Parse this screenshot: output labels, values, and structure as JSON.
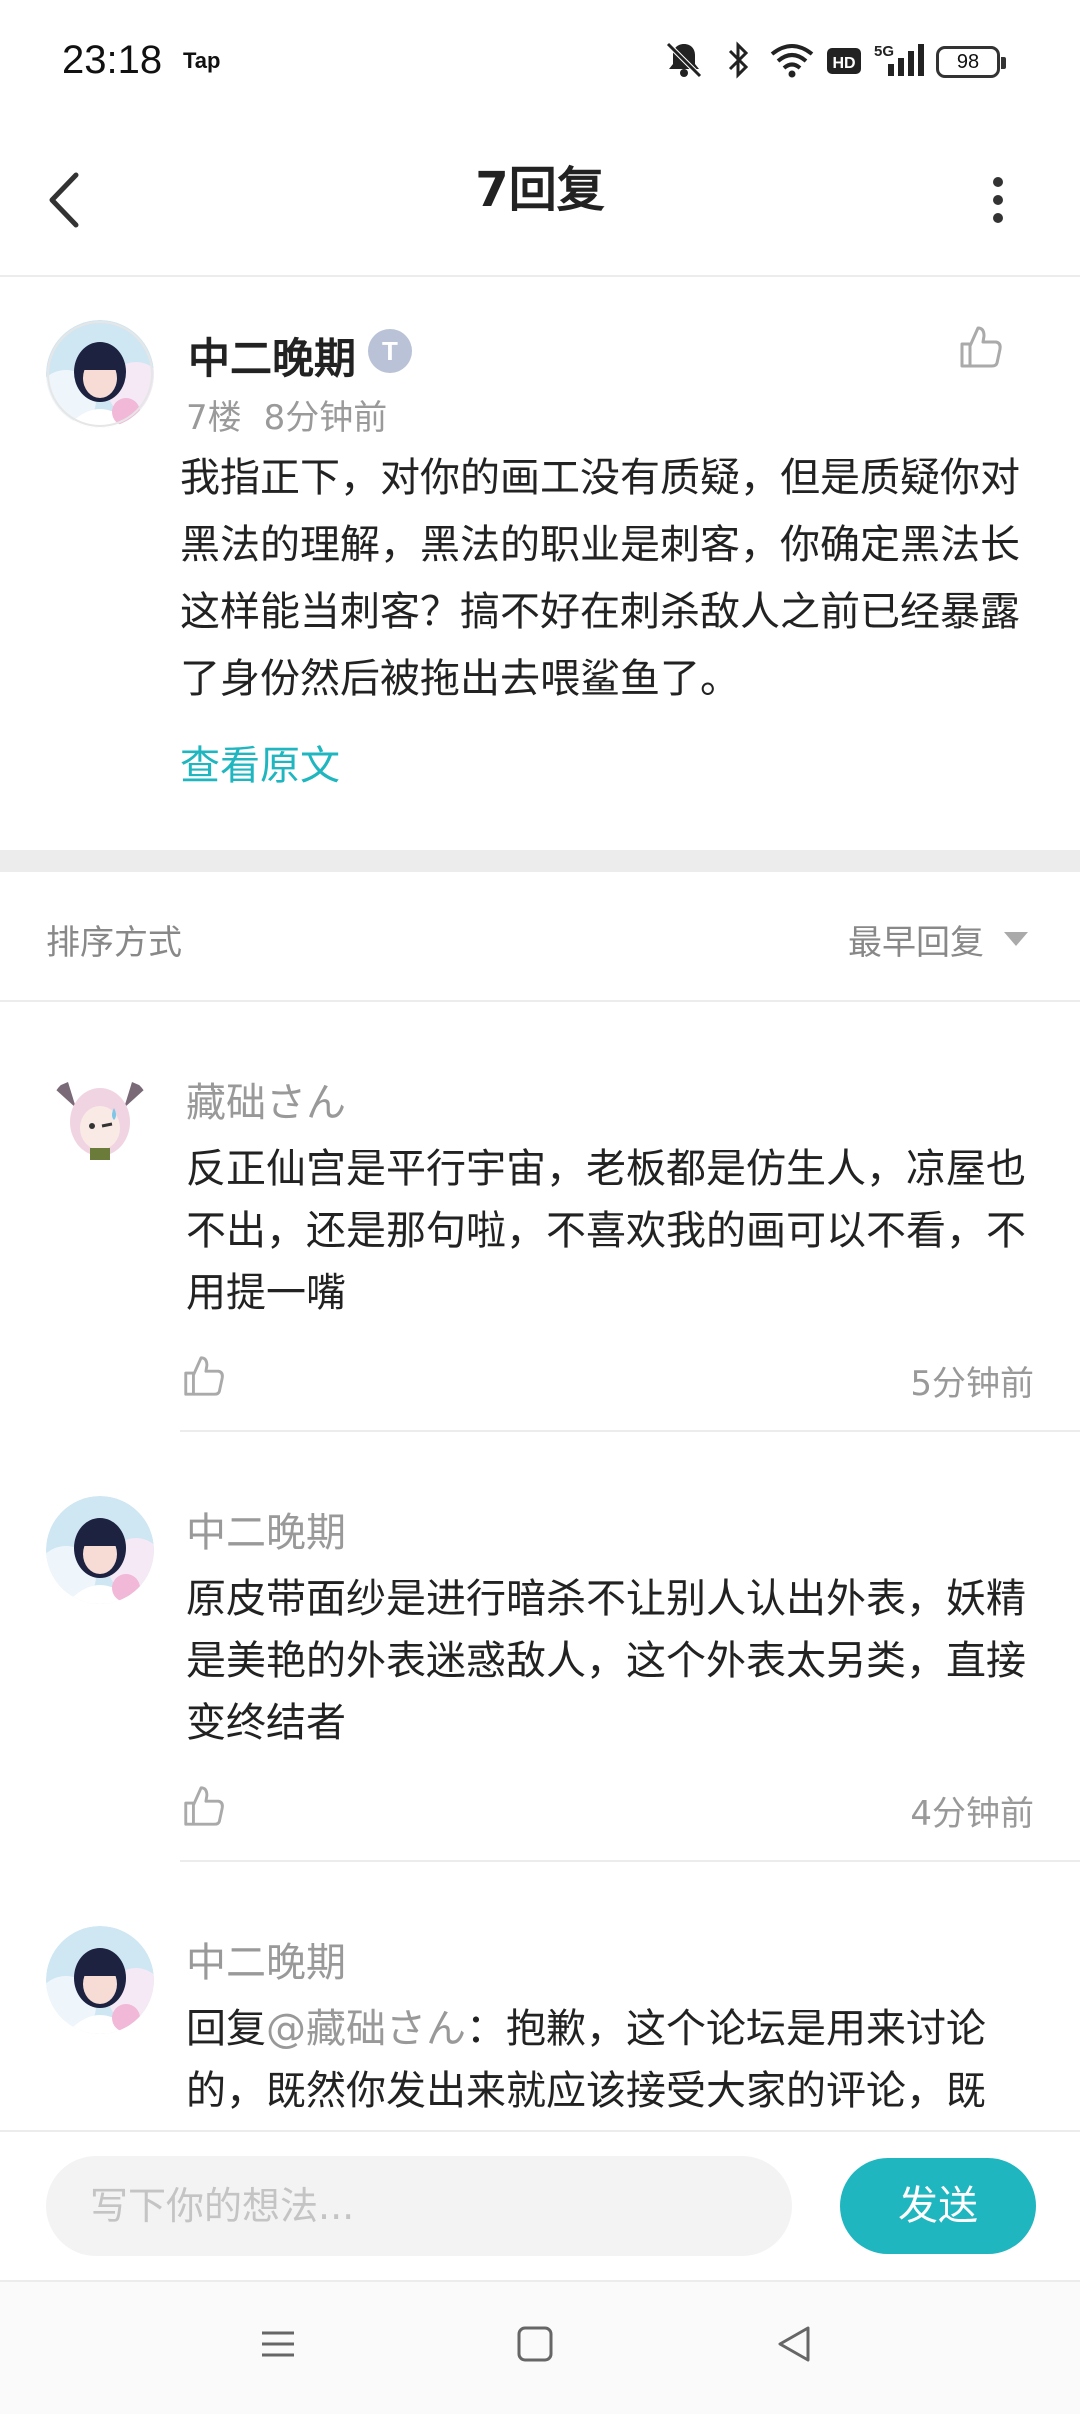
{
  "status_bar": {
    "time": "23:18",
    "app_tag": "Tap",
    "battery": "98",
    "icons": [
      "mute-bell-icon",
      "bluetooth-icon",
      "wifi-icon",
      "hd-icon",
      "5g-signal-icon",
      "battery-icon"
    ]
  },
  "header": {
    "title": "7回复",
    "back_icon": "chevron-left-icon",
    "more_icon": "more-vertical-icon"
  },
  "main_post": {
    "username": "中二晚期",
    "badge": "T",
    "floor": "7楼",
    "time": "8分钟前",
    "text": "我指正下，对你的画工没有质疑，但是质疑你对黑法的理解，黑法的职业是刺客，你确定黑法长这样能当刺客？搞不好在刺杀敌人之前已经暴露了身份然后被拖出去喂鲨鱼了。",
    "view_original": "查看原文"
  },
  "sort": {
    "label": "排序方式",
    "value": "最早回复"
  },
  "replies": [
    {
      "username": "藏础さん",
      "text": "反正仙宫是平行宇宙，老板都是仿生人，凉屋也不出，还是那句啦，不喜欢我的画可以不看，不用提一嘴",
      "time": "5分钟前"
    },
    {
      "username": "中二晚期",
      "text": "原皮带面纱是进行暗杀不让别人认出外表，妖精是美艳的外表迷惑敌人，这个外表太另类，直接变终结者",
      "time": "4分钟前"
    },
    {
      "username": "中二晚期",
      "reply_prefix": "回复",
      "mention": "@藏础さん",
      "text": "：抱歉，这个论坛是用来讨论的，既然你发出来就应该接受大家的评论，既"
    }
  ],
  "input": {
    "placeholder": "写下你的想法...",
    "send_label": "发送"
  },
  "nav": {
    "icons": [
      "menu-icon",
      "home-square-icon",
      "back-triangle-icon"
    ]
  },
  "colors": {
    "accent": "#1fb6c0",
    "muted_text": "#999999",
    "divider": "#ececec"
  }
}
